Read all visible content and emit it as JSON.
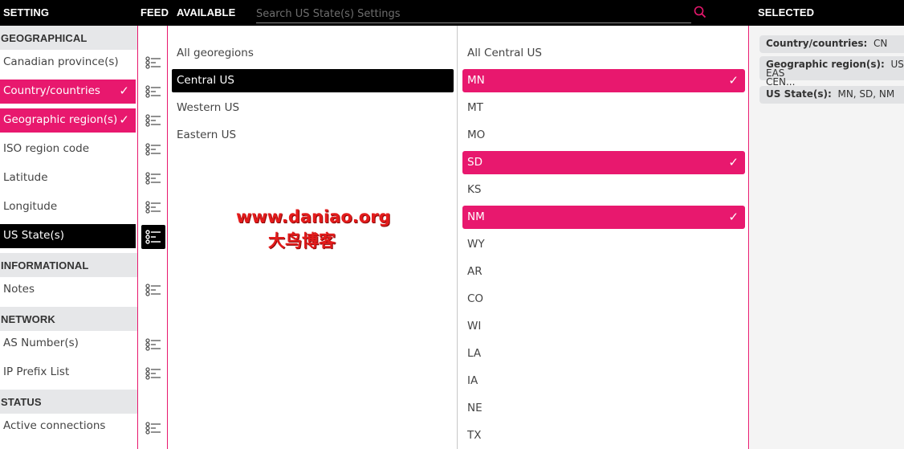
{
  "header": {
    "setting": "SETTING",
    "feed": "FEED",
    "available": "AVAILABLE",
    "search_placeholder": "Search US State(s) Settings",
    "selected": "SELECTED"
  },
  "settings": {
    "geographical": "GEOGRAPHICAL",
    "canadian": "Canadian province(s)",
    "country": "Country/countries",
    "geo_region": "Geographic region(s)",
    "iso": "ISO region code",
    "latitude": "Latitude",
    "longitude": "Longitude",
    "us_states": "US State(s)",
    "informational": "INFORMATIONAL",
    "notes": "Notes",
    "network": "NETWORK",
    "as_number": "AS Number(s)",
    "ip_prefix": "IP Prefix List",
    "status": "STATUS",
    "active_connections": "Active connections",
    "check": "✓"
  },
  "regions": [
    "All georegions",
    "Central US",
    "Western US",
    "Eastern US"
  ],
  "states": [
    "All Central US",
    "MN",
    "MT",
    "MO",
    "SD",
    "KS",
    "NM",
    "WY",
    "AR",
    "CO",
    "WI",
    "LA",
    "IA",
    "NE",
    "TX"
  ],
  "selected": {
    "country_label": "Country/countries:",
    "country_value": "CN",
    "region_label": "Geographic region(s):",
    "region_value": "US-EAS",
    "region_value2": "CEN...",
    "states_label": "US State(s):",
    "states_value": "MN, SD, NM"
  },
  "watermark": {
    "url": "www.daniao.org",
    "name": "大鸟博客"
  },
  "colors": {
    "accent": "#e8186e",
    "header_bg": "#000000",
    "section_bg": "#e6e7e9",
    "selected_bg": "#f4f4f4"
  },
  "icons": {
    "search": "search-icon",
    "feed": "feed-filter-icon",
    "check": "checkmark-icon"
  }
}
